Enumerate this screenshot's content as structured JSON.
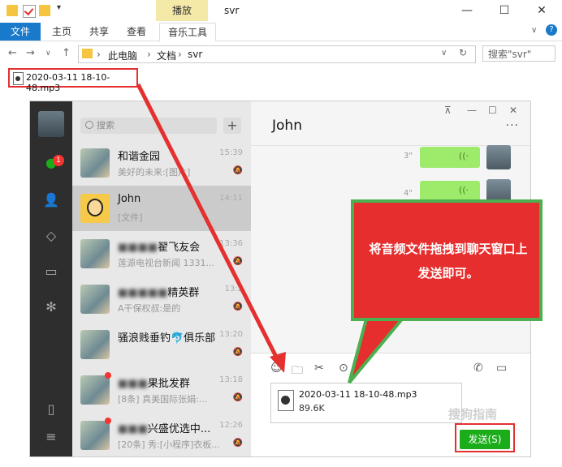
{
  "explorer": {
    "ribbon_context_tab": "播放",
    "window_title": "svr",
    "tabs": {
      "file": "文件",
      "home": "主页",
      "share": "共享",
      "view": "查看",
      "music_tools": "音乐工具"
    },
    "breadcrumb": [
      "此电脑",
      "文档",
      "svr"
    ],
    "search_placeholder": "搜索\"svr\"",
    "file_name": "2020-03-11 18-10-48.mp3",
    "win_controls": {
      "minimize": "—",
      "maximize": "☐",
      "close": "✕"
    }
  },
  "wechat": {
    "search_placeholder": "搜索",
    "chat_badge": "1",
    "chat_title": "John",
    "conversations": [
      {
        "name": "和谐金园",
        "preview": "美好的未来:[图片]",
        "time": "15:39"
      },
      {
        "name": "John",
        "preview": "[文件]",
        "time": "14:11"
      },
      {
        "name": "翟飞友会",
        "preview": "莲源电视台新闻 1331...",
        "time": "13:36"
      },
      {
        "name": "精英群",
        "preview": "A干保权叔:是的",
        "time": "13:2"
      },
      {
        "name": "骚浪贱垂钓🐬俱乐部",
        "preview": "",
        "time": "13:20"
      },
      {
        "name": "果批发群",
        "preview": "[8条] 真美国际张娟:...",
        "time": "13:18"
      },
      {
        "name": "兴盛优选中...",
        "preview": "[20条] 秀:[小程序]衣板...",
        "time": "12:26"
      }
    ],
    "messages": [
      {
        "duration": "3\""
      },
      {
        "duration": "4\""
      }
    ],
    "attachment": {
      "name": "2020-03-11 18-10-48.mp3",
      "size": "89.6K"
    },
    "send_label": "发送(S)"
  },
  "callout": {
    "text": "将音频文件拖拽到聊天窗口上发送即可。"
  },
  "watermark": "搜狗指南",
  "colors": {
    "accent": "#1979ca",
    "send_green": "#1aad19",
    "callout_red": "#e62e2e",
    "callout_border": "#4cb050",
    "bubble_green": "#9eea6a"
  }
}
